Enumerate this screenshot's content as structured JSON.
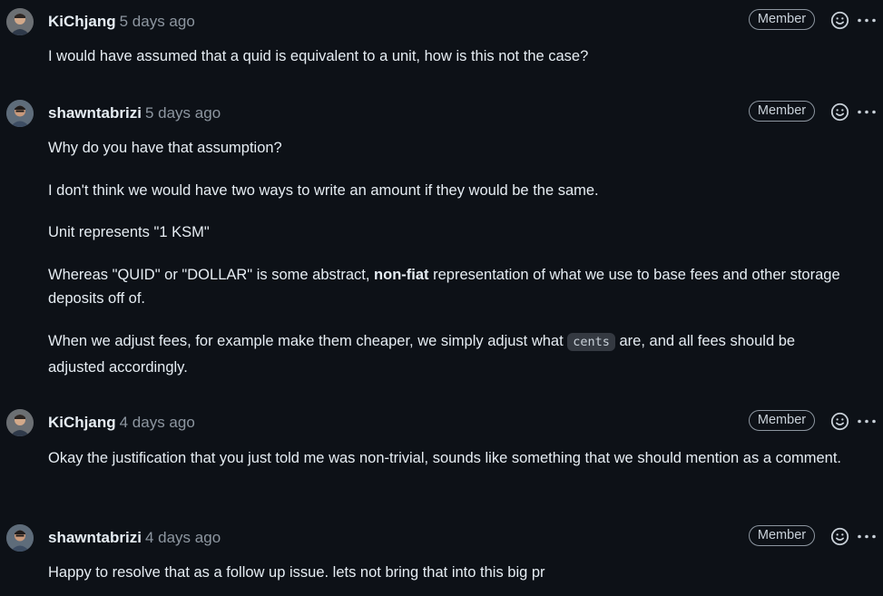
{
  "comments": [
    {
      "author": "KiChjang",
      "time": "5 days ago",
      "badge": "Member",
      "paragraphs": [
        "I would have assumed that a quid is equivalent to a unit, how is this not the case?"
      ]
    },
    {
      "author": "shawntabrizi",
      "time": "5 days ago",
      "badge": "Member",
      "p1": "Why do you have that assumption?",
      "p2": "I don't think we would have two ways to write an amount if they would be the same.",
      "p3": "Unit represents \"1 KSM\"",
      "p4_pre": "Whereas \"QUID\" or \"DOLLAR\" is some abstract, ",
      "p4_bold": "non-fiat",
      "p4_post": " representation of what we use to base fees and other storage deposits off of.",
      "p5_pre": "When we adjust fees, for example make them cheaper, we simply adjust what ",
      "p5_code": "cents",
      "p5_post": " are, and all fees should be adjusted accordingly."
    },
    {
      "author": "KiChjang",
      "time": "4 days ago",
      "badge": "Member",
      "paragraphs": [
        "Okay the justification that you just told me was non-trivial, sounds like something that we should mention as a comment."
      ]
    },
    {
      "author": "shawntabrizi",
      "time": "4 days ago",
      "badge": "Member",
      "paragraphs": [
        "Happy to resolve that as a follow up issue. lets not bring that into this big pr"
      ]
    }
  ],
  "icons": {
    "reaction": "smiley-icon",
    "menu": "kebab-icon",
    "avatar": "user-avatar"
  },
  "colors": {
    "background": "#0d1117",
    "text": "#e6edf3",
    "muted": "#8d96a0"
  }
}
